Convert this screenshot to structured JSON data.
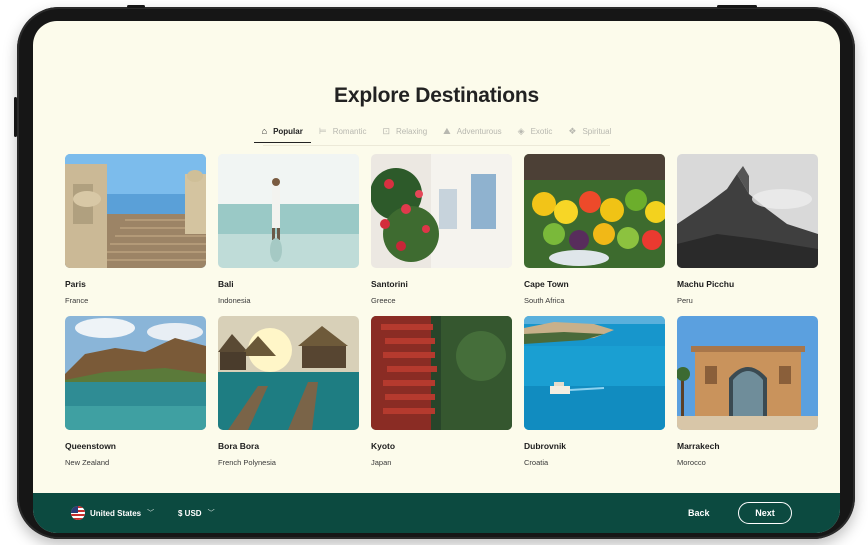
{
  "title": "Explore Destinations",
  "tabs": [
    {
      "label": "Popular",
      "icon": "home-icon",
      "active": true
    },
    {
      "label": "Romantic",
      "icon": "bed-icon",
      "active": false
    },
    {
      "label": "Relaxing",
      "icon": "lounge-icon",
      "active": false
    },
    {
      "label": "Adventurous",
      "icon": "hiking-icon",
      "active": false
    },
    {
      "label": "Exotic",
      "icon": "compass-icon",
      "active": false
    },
    {
      "label": "Spiritual",
      "icon": "lotus-icon",
      "active": false
    }
  ],
  "destinations": [
    {
      "name": "Paris",
      "country": "France"
    },
    {
      "name": "Bali",
      "country": "Indonesia"
    },
    {
      "name": "Santorini",
      "country": "Greece"
    },
    {
      "name": "Cape Town",
      "country": "South Africa"
    },
    {
      "name": "Machu Picchu",
      "country": "Peru"
    },
    {
      "name": "Queenstown",
      "country": "New Zealand"
    },
    {
      "name": "Bora Bora",
      "country": "French Polynesia"
    },
    {
      "name": "Kyoto",
      "country": "Japan"
    },
    {
      "name": "Dubrovnik",
      "country": "Croatia"
    },
    {
      "name": "Marrakech",
      "country": "Morocco"
    }
  ],
  "footer": {
    "country": "United States",
    "currency": "$ USD",
    "back_label": "Back",
    "next_label": "Next"
  },
  "colors": {
    "background": "#fcfbeb",
    "footer": "#0c4a40",
    "text": "#222222"
  }
}
